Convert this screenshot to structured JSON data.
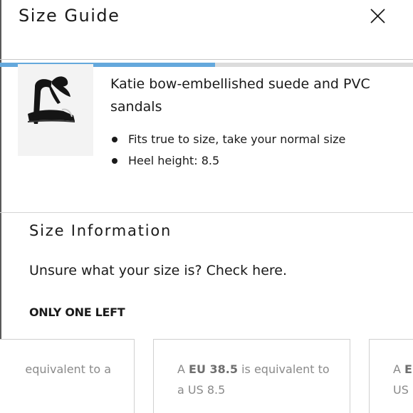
{
  "header": {
    "title": "Size Guide",
    "close_icon": "close-icon"
  },
  "progress": {
    "fraction": 0.52,
    "fill_color": "#64a8dc",
    "track_color": "#dcdcdc"
  },
  "product": {
    "image_icon": "sandal-thumbnail",
    "name": "Katie bow-embellished suede and PVC sandals",
    "bullets": [
      "Fits true to size, take your normal size",
      "Heel height: 8.5"
    ]
  },
  "size_information": {
    "title": "Size Information",
    "help_link": "Unsure what your size is? Check here.",
    "stock_status": "ONLY ONE LEFT"
  },
  "size_cards": [
    {
      "line1_text": "equivalent to a",
      "line2_text": ""
    },
    {
      "line1_prefix": "A ",
      "line1_bold": "EU 38.5",
      "line1_suffix": " is equivalent to",
      "line2_text": "a US 8.5"
    },
    {
      "line1_prefix": "A ",
      "line1_bold": "EU",
      "line2_text": "US"
    }
  ]
}
